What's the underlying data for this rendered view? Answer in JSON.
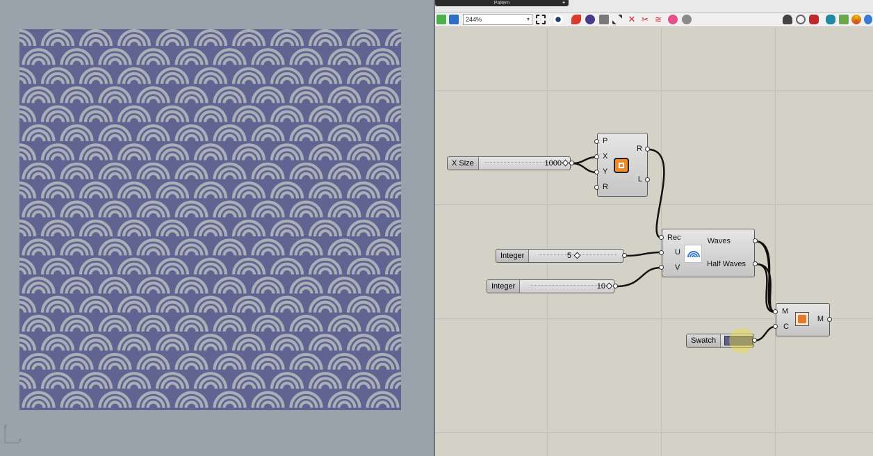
{
  "window": {
    "title": "Pattern"
  },
  "viewport": {
    "axis_y": "y",
    "axis_x": "x",
    "pattern_colors": {
      "background": "#5f6590",
      "arc": "#a9aeb7",
      "viewport_bg": "#9aa2ac"
    }
  },
  "toolbar": {
    "zoom_value": "244%",
    "icons": [
      "open-file-icon",
      "save-icon",
      "zoom-extents-icon",
      "preview-eye-icon",
      "paint-icon",
      "bake-icon",
      "canvas-icon",
      "wire-icon",
      "disable-icon",
      "cluster-icon",
      "split-icon",
      "sphere-icon",
      "gear-icon",
      "shade-icon",
      "wire-display-icon",
      "shaded-icon",
      "material-icon",
      "color-icon",
      "light-icon",
      "globe-icon"
    ]
  },
  "components": {
    "slider_x": {
      "label": "X Size",
      "value": "1000"
    },
    "rectangle": {
      "inputs": [
        "P",
        "X",
        "Y",
        "R"
      ],
      "outputs": [
        "R",
        "L"
      ]
    },
    "slider_u": {
      "label": "Integer",
      "value": "5"
    },
    "slider_v": {
      "label": "Integer",
      "value": "10"
    },
    "waves": {
      "inputs": [
        "Rec",
        "U",
        "V"
      ],
      "outputs": [
        "Waves",
        "Half Waves"
      ]
    },
    "swatch": {
      "label": "Swatch",
      "color": "#5a5f8c"
    },
    "preview": {
      "inputs": [
        "M",
        "C"
      ],
      "outputs": [
        "M"
      ]
    }
  }
}
